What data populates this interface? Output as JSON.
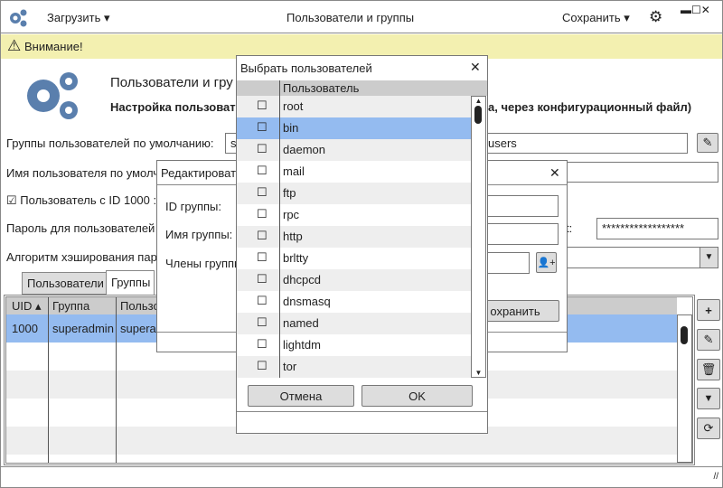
{
  "app": {
    "title": "Пользователи и группы",
    "load_menu": "Загрузить",
    "save_menu": "Сохранить"
  },
  "warning": {
    "text": "Внимание!"
  },
  "header": {
    "title": "Пользователи и гру",
    "subtitle_left": "Настройка пользовате",
    "subtitle_right": "а, через конфигурационный файл)"
  },
  "form": {
    "default_groups_label": "Группы пользователей по умолчанию:",
    "default_groups_value_left": "s",
    "default_groups_value_right": "users",
    "default_user_label": "Имя пользователя по умолча",
    "uid1000_label": "Пользователь с ID 1000 :",
    "uid1000_checked": true,
    "password_label": "Пароль для пользователей г",
    "password_label_tail": "t:",
    "password_value": "******************",
    "hash_label": "Алгоритм хэширования парол"
  },
  "tabs": [
    {
      "label": "Пользователи",
      "active": false
    },
    {
      "label": "Группы",
      "active": true
    }
  ],
  "table": {
    "columns": [
      "UID",
      "Группа",
      "Пользо"
    ],
    "rows": [
      {
        "uid": "1000",
        "group": "superadmin",
        "users": "superad",
        "selected": true
      }
    ]
  },
  "edit_dialog": {
    "title": "Редактироват",
    "id_label": "ID группы:",
    "name_label": "Имя группы:",
    "members_label": "Члены группы",
    "save_label": "охранить"
  },
  "select_dialog": {
    "title": "Выбрать пользователей",
    "column": "Пользователь",
    "users": [
      {
        "name": "root",
        "checked": false
      },
      {
        "name": "bin",
        "checked": false,
        "selected": true
      },
      {
        "name": "daemon",
        "checked": false
      },
      {
        "name": "mail",
        "checked": false
      },
      {
        "name": "ftp",
        "checked": false
      },
      {
        "name": "rpc",
        "checked": false
      },
      {
        "name": "http",
        "checked": false
      },
      {
        "name": "brltty",
        "checked": false
      },
      {
        "name": "dhcpcd",
        "checked": false
      },
      {
        "name": "dnsmasq",
        "checked": false
      },
      {
        "name": "named",
        "checked": false
      },
      {
        "name": "lightdm",
        "checked": false
      },
      {
        "name": "tor",
        "checked": false
      }
    ],
    "cancel_label": "Отмена",
    "ok_label": "OK"
  },
  "colors": {
    "accent": "#5a7fad",
    "selection": "#94bbf0",
    "warning_bg": "#f3f0b0"
  }
}
